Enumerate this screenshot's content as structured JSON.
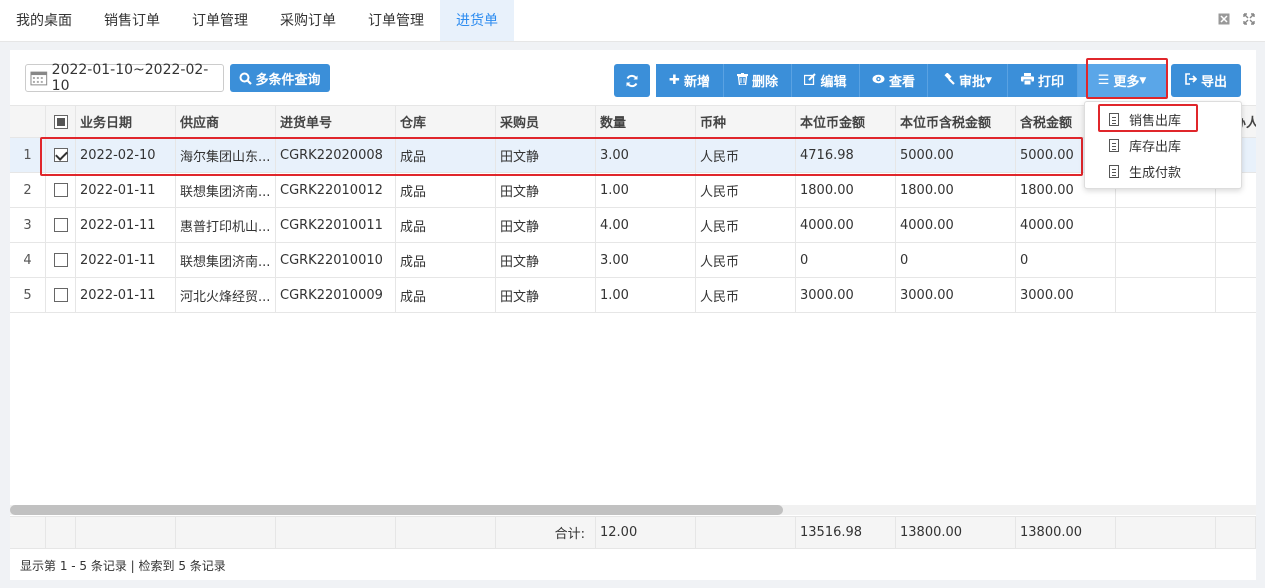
{
  "tabs": [
    "我的桌面",
    "销售订单",
    "订单管理",
    "采购订单",
    "订单管理",
    "进货单"
  ],
  "active_tab": 5,
  "toolbar": {
    "date_range": "2022-01-10~2022-02-10",
    "query_label": "多条件查询",
    "add_label": "新增",
    "delete_label": "删除",
    "edit_label": "编辑",
    "view_label": "查看",
    "approve_label": "审批",
    "print_label": "打印",
    "more_label": "更多",
    "export_label": "导出"
  },
  "more_menu": [
    "销售出库",
    "库存出库",
    "生成付款"
  ],
  "table": {
    "headers": [
      "业务日期",
      "供应商",
      "进货单号",
      "仓库",
      "采购员",
      "数量",
      "币种",
      "本位币金额",
      "本位币含税金额",
      "含税金额",
      "",
      "经办人"
    ],
    "rows": [
      {
        "idx": "1",
        "checked": true,
        "cells": [
          "2022-02-10",
          "海尔集团山东...",
          "CGRK22020008",
          "成品",
          "田文静",
          "3.00",
          "人民币",
          "4716.98",
          "5000.00",
          "5000.00"
        ]
      },
      {
        "idx": "2",
        "checked": false,
        "cells": [
          "2022-01-11",
          "联想集团济南...",
          "CGRK22010012",
          "成品",
          "田文静",
          "1.00",
          "人民币",
          "1800.00",
          "1800.00",
          "1800.00"
        ]
      },
      {
        "idx": "3",
        "checked": false,
        "cells": [
          "2022-01-11",
          "惠普打印机山...",
          "CGRK22010011",
          "成品",
          "田文静",
          "4.00",
          "人民币",
          "4000.00",
          "4000.00",
          "4000.00"
        ]
      },
      {
        "idx": "4",
        "checked": false,
        "cells": [
          "2022-01-11",
          "联想集团济南...",
          "CGRK22010010",
          "成品",
          "田文静",
          "3.00",
          "人民币",
          "0",
          "0",
          "0"
        ]
      },
      {
        "idx": "5",
        "checked": false,
        "cells": [
          "2022-01-11",
          "河北火烽经贸...",
          "CGRK22010009",
          "成品",
          "田文静",
          "1.00",
          "人民币",
          "3000.00",
          "3000.00",
          "3000.00"
        ]
      }
    ]
  },
  "summary": {
    "label": "合计:",
    "qty": "12.00",
    "amt": "13516.98",
    "taxamt": "13800.00",
    "tax": "13800.00"
  },
  "pager": "显示第 1 - 5 条记录 | 检索到 5 条记录",
  "colors": {
    "accent": "#3b8fd9",
    "highlight": "#e0262b",
    "selected_row": "#e8f1fb"
  }
}
